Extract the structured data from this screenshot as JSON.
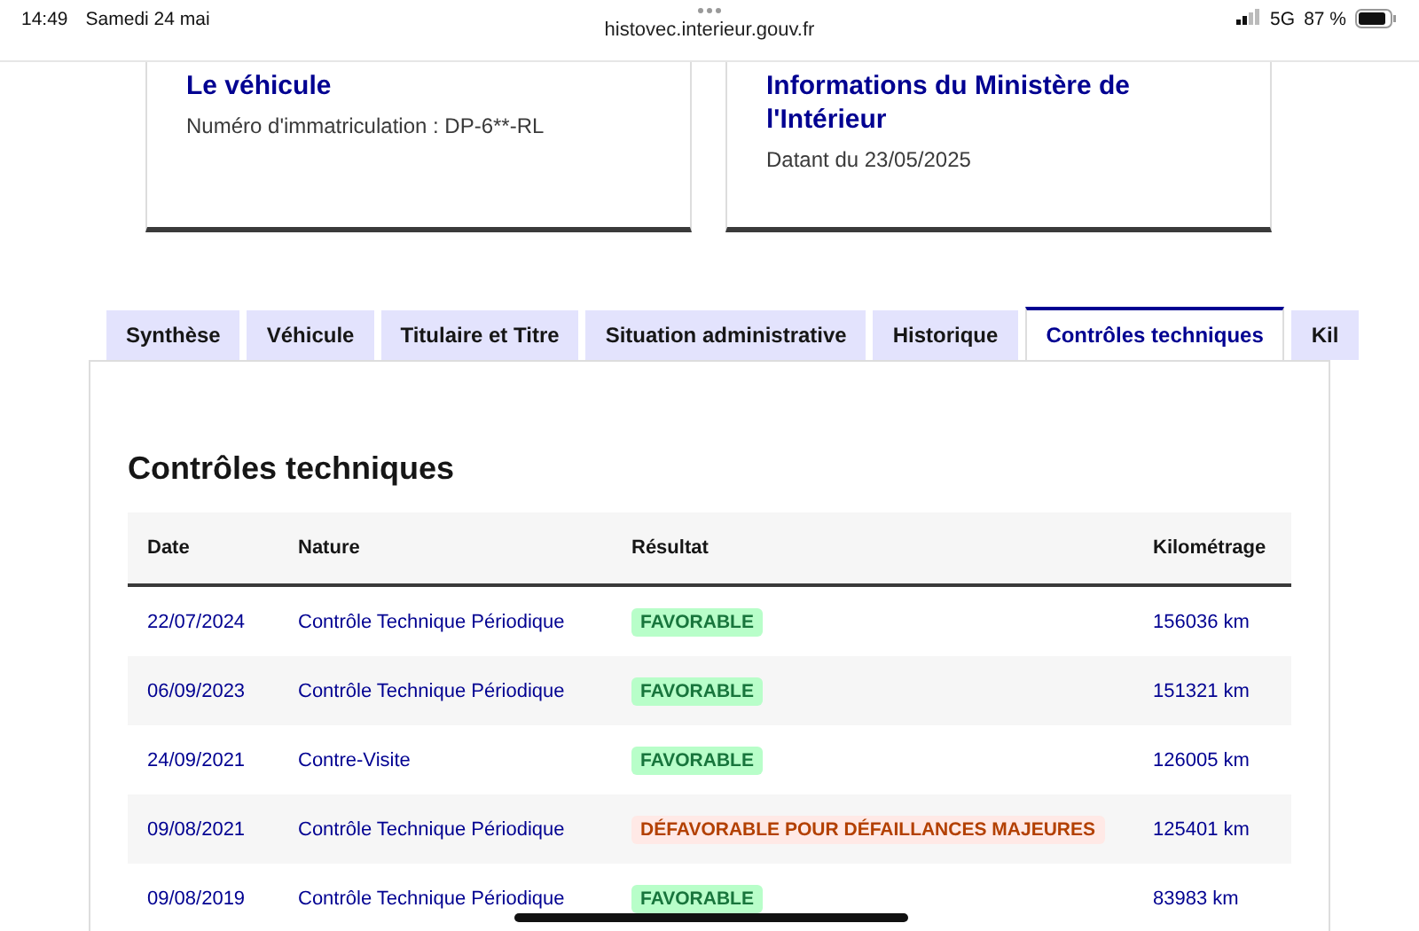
{
  "status_bar": {
    "time": "14:49",
    "date": "Samedi 24 mai",
    "url": "histovec.interieur.gouv.fr",
    "network": "5G",
    "battery": "87 %"
  },
  "cards": [
    {
      "title": "Le véhicule",
      "text": "Numéro d'immatriculation : DP-6**-RL"
    },
    {
      "title": "Informations du Ministère de l'Intérieur",
      "text": "Datant du 23/05/2025"
    }
  ],
  "tabs": [
    {
      "label": "Synthèse",
      "selected": false
    },
    {
      "label": "Véhicule",
      "selected": false
    },
    {
      "label": "Titulaire et Titre",
      "selected": false
    },
    {
      "label": "Situation administrative",
      "selected": false
    },
    {
      "label": "Historique",
      "selected": false
    },
    {
      "label": "Contrôles techniques",
      "selected": true
    },
    {
      "label": "Kil",
      "selected": false
    }
  ],
  "section_title": "Contrôles techniques",
  "table": {
    "columns": [
      "Date",
      "Nature",
      "Résultat",
      "Kilométrage"
    ],
    "rows": [
      {
        "date": "22/07/2024",
        "nature": "Contrôle Technique Périodique",
        "result": "FAVORABLE",
        "kind": "favorable",
        "mileage": "156036 km"
      },
      {
        "date": "06/09/2023",
        "nature": "Contrôle Technique Périodique",
        "result": "FAVORABLE",
        "kind": "favorable",
        "mileage": "151321 km"
      },
      {
        "date": "24/09/2021",
        "nature": "Contre-Visite",
        "result": "FAVORABLE",
        "kind": "favorable",
        "mileage": "126005 km"
      },
      {
        "date": "09/08/2021",
        "nature": "Contrôle Technique Périodique",
        "result": "DÉFAVORABLE POUR DÉFAILLANCES MAJEURES",
        "kind": "defavorable",
        "mileage": "125401 km"
      },
      {
        "date": "09/08/2019",
        "nature": "Contrôle Technique Périodique",
        "result": "FAVORABLE",
        "kind": "favorable",
        "mileage": "83983 km"
      }
    ]
  }
}
